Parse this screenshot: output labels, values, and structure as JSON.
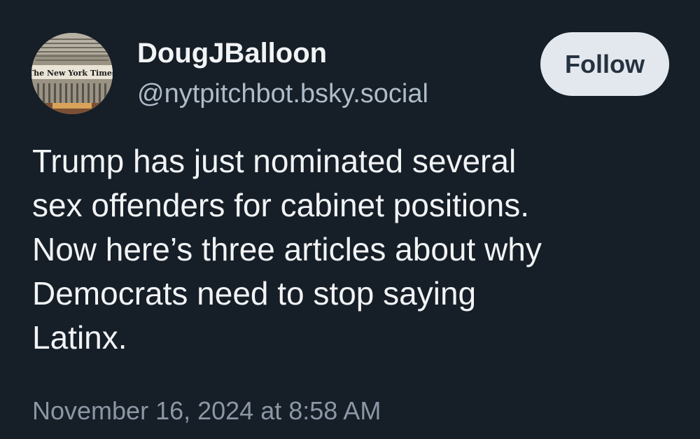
{
  "author": {
    "display_name": "DougJBalloon",
    "handle": "@nytpitchbot.bsky.social",
    "avatar_text": "The New York Times",
    "avatar_icon": "nyt-building-avatar"
  },
  "follow_button": {
    "label": "Follow"
  },
  "post": {
    "lines": [
      "Trump has just nominated several",
      "sex offenders for cabinet positions.",
      "Now here’s three articles about why",
      "Democrats need to stop saying",
      "Latinx."
    ],
    "timestamp": "November 16, 2024 at 8:58 AM"
  },
  "colors": {
    "background": "#161e27",
    "text_primary": "#f1f3f5",
    "text_secondary": "#aebbc9",
    "timestamp": "#8b97a5",
    "follow_bg": "#e3e8ee",
    "follow_text": "#263240"
  }
}
